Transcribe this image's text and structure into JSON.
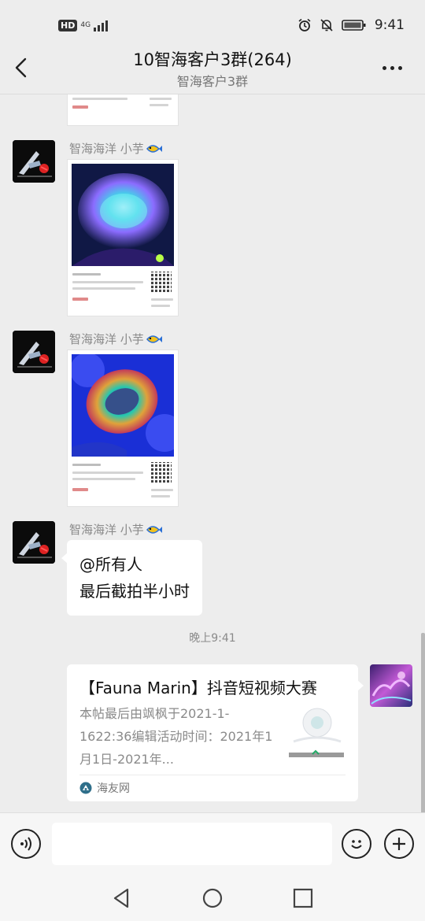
{
  "status_bar": {
    "hd_label": "HD",
    "network_label": "4G",
    "time": "9:41"
  },
  "header": {
    "title": "10智海客户3群(264)",
    "subtitle": "智海客户3群"
  },
  "messages": [
    {
      "sender": "智海海洋 小芋",
      "type": "product-card",
      "photo_colors": {
        "accent": "#3fd7e8",
        "glow": "#8b6cff",
        "background": "#101845"
      }
    },
    {
      "sender": "智海海洋 小芋",
      "type": "product-card",
      "photo_colors": {
        "accent": "#e0a23a",
        "glow": "#26c7b0",
        "background": "#1a2fd6"
      }
    },
    {
      "sender": "智海海洋 小芋",
      "type": "text",
      "lines": [
        "@所有人",
        "最后截拍半小时"
      ]
    }
  ],
  "timestamp": "晚上9:41",
  "link_card": {
    "title": "【Fauna Marin】抖音短视频大赛",
    "description": "本帖最后由飒枫于2021-1-1622:36编辑活动时间：2021年1月1日-2021年...",
    "source": "海友网"
  },
  "input": {
    "placeholder": ""
  },
  "colors": {
    "background": "#ededed",
    "bubble": "#ffffff",
    "meta_text": "#8a8a8a",
    "price_red": "#e08a8a"
  }
}
